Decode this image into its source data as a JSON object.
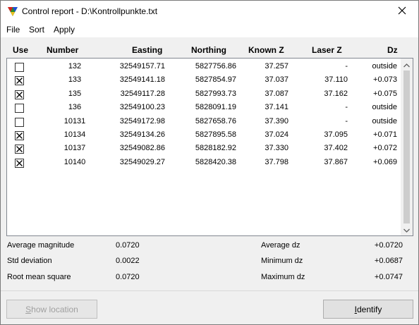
{
  "window": {
    "title": "Control report - D:\\Kontrollpunkte.txt",
    "app_icon": "triangle-color-icon",
    "close_icon": "close-icon"
  },
  "menu": {
    "items": [
      {
        "label": "File"
      },
      {
        "label": "Sort"
      },
      {
        "label": "Apply"
      }
    ]
  },
  "table": {
    "headers": {
      "use": "Use",
      "number": "Number",
      "easting": "Easting",
      "northing": "Northing",
      "known_z": "Known Z",
      "laser_z": "Laser Z",
      "dz": "Dz"
    },
    "rows": [
      {
        "use": false,
        "number": "132",
        "easting": "32549157.71",
        "northing": "5827756.86",
        "known_z": "37.257",
        "laser_z": "-",
        "dz": "outside"
      },
      {
        "use": true,
        "number": "133",
        "easting": "32549141.18",
        "northing": "5827854.97",
        "known_z": "37.037",
        "laser_z": "37.110",
        "dz": "+0.073"
      },
      {
        "use": true,
        "number": "135",
        "easting": "32549117.28",
        "northing": "5827993.73",
        "known_z": "37.087",
        "laser_z": "37.162",
        "dz": "+0.075"
      },
      {
        "use": false,
        "number": "136",
        "easting": "32549100.23",
        "northing": "5828091.19",
        "known_z": "37.141",
        "laser_z": "-",
        "dz": "outside"
      },
      {
        "use": false,
        "number": "10131",
        "easting": "32549172.98",
        "northing": "5827658.76",
        "known_z": "37.390",
        "laser_z": "-",
        "dz": "outside"
      },
      {
        "use": true,
        "number": "10134",
        "easting": "32549134.26",
        "northing": "5827895.58",
        "known_z": "37.024",
        "laser_z": "37.095",
        "dz": "+0.071"
      },
      {
        "use": true,
        "number": "10137",
        "easting": "32549082.86",
        "northing": "5828182.92",
        "known_z": "37.330",
        "laser_z": "37.402",
        "dz": "+0.072"
      },
      {
        "use": true,
        "number": "10140",
        "easting": "32549029.27",
        "northing": "5828420.38",
        "known_z": "37.798",
        "laser_z": "37.867",
        "dz": "+0.069"
      }
    ]
  },
  "stats": {
    "avg_magnitude_label": "Average magnitude",
    "avg_magnitude_value": "0.0720",
    "std_dev_label": "Std deviation",
    "std_dev_value": "0.0022",
    "rms_label": "Root mean square",
    "rms_value": "0.0720",
    "avg_dz_label": "Average dz",
    "avg_dz_value": "+0.0720",
    "min_dz_label": "Minimum dz",
    "min_dz_value": "+0.0687",
    "max_dz_label": "Maximum dz",
    "max_dz_value": "+0.0747"
  },
  "buttons": {
    "show_location_label": "Show location",
    "identify_label": "Identify"
  }
}
